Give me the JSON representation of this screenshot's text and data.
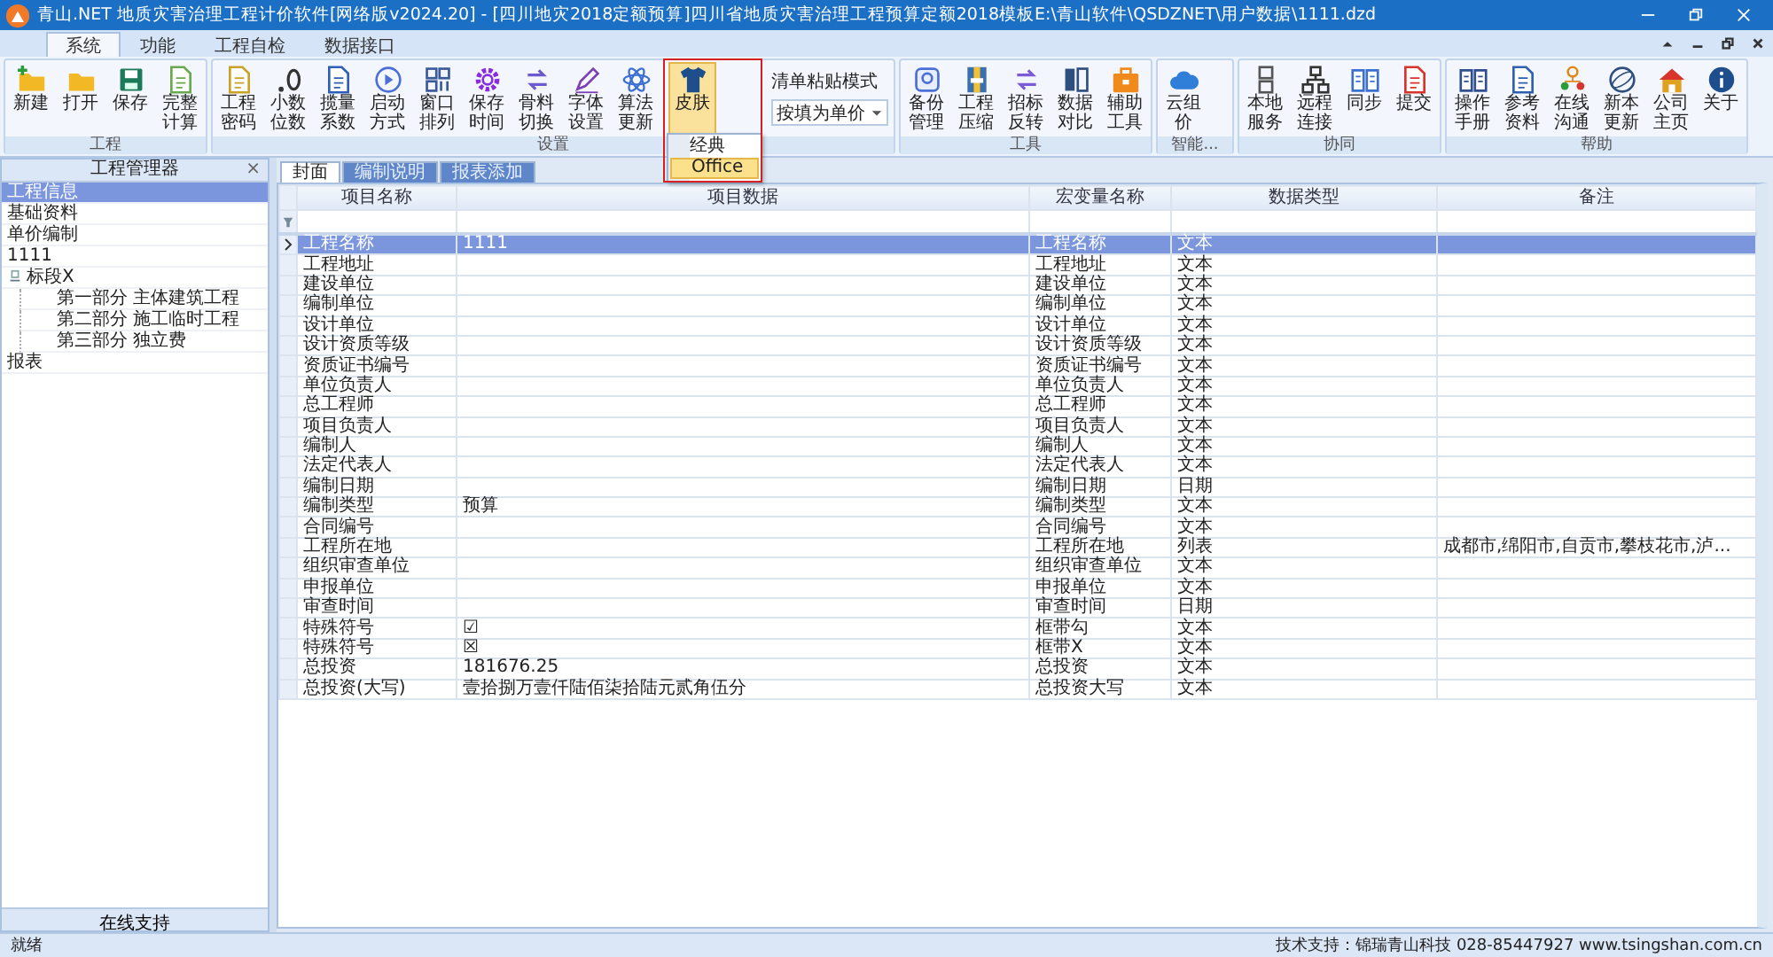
{
  "window": {
    "title": "青山.NET 地质灾害治理工程计价软件[网络版v2024.20] - [四川地灾2018定额预算]四川省地质灾害治理工程预算定额2018模板E:\\青山软件\\QSDZNET\\用户数据\\1111.dzd"
  },
  "ribbon_tabs": [
    {
      "label": "系统",
      "selected": true
    },
    {
      "label": "功能",
      "selected": false
    },
    {
      "label": "工程自检",
      "selected": false
    },
    {
      "label": "数据接口",
      "selected": false
    }
  ],
  "ribbon_groups": [
    {
      "label": "工程",
      "items": [
        {
          "kind": "button",
          "label": "新建"
        },
        {
          "kind": "button",
          "label": "打开"
        },
        {
          "kind": "button",
          "label": "保存"
        },
        {
          "kind": "button",
          "label": "完整计算"
        }
      ]
    },
    {
      "label": "设置",
      "items": [
        {
          "kind": "button",
          "label": "工程密码"
        },
        {
          "kind": "button",
          "label": "小数位数"
        },
        {
          "kind": "button",
          "label": "揽量系数"
        },
        {
          "kind": "button",
          "label": "启动方式"
        },
        {
          "kind": "button",
          "label": "窗口排列"
        },
        {
          "kind": "button",
          "label": "保存时间"
        },
        {
          "kind": "button",
          "label": "骨料切换"
        },
        {
          "kind": "button",
          "label": "字体设置"
        },
        {
          "kind": "button",
          "label": "算法更新"
        },
        {
          "kind": "button",
          "label": "皮肤",
          "menu": [
            {
              "label": "经典",
              "selected": false
            },
            {
              "label": "Office",
              "selected": true
            }
          ]
        },
        {
          "kind": "combo",
          "label": "清单粘贴模式",
          "value": "按填为单价"
        }
      ]
    },
    {
      "label": "工具",
      "items": [
        {
          "kind": "button",
          "label": "备份管理"
        },
        {
          "kind": "button",
          "label": "工程压缩"
        },
        {
          "kind": "button",
          "label": "招标反转"
        },
        {
          "kind": "button",
          "label": "数据对比"
        },
        {
          "kind": "button",
          "label": "辅助工具"
        }
      ]
    },
    {
      "label": "智能...",
      "items": [
        {
          "kind": "button",
          "label": "云组价"
        }
      ]
    },
    {
      "label": "协同",
      "items": [
        {
          "kind": "button",
          "label": "本地服务"
        },
        {
          "kind": "button",
          "label": "远程连接"
        },
        {
          "kind": "button",
          "label": "同步"
        },
        {
          "kind": "button",
          "label": "提交"
        }
      ]
    },
    {
      "label": "帮助",
      "items": [
        {
          "kind": "button",
          "label": "操作手册"
        },
        {
          "kind": "button",
          "label": "参考资料"
        },
        {
          "kind": "button",
          "label": "在线沟通"
        },
        {
          "kind": "button",
          "label": "新本更新"
        },
        {
          "kind": "button",
          "label": "公司主页"
        },
        {
          "kind": "button",
          "label": "关于"
        }
      ]
    }
  ],
  "sidebar": {
    "title": "工程管理器",
    "close": "×",
    "items": [
      {
        "label": "工程信息",
        "selected": true
      },
      {
        "label": "基础资料",
        "selected": false
      },
      {
        "label": "单价编制",
        "selected": false
      },
      {
        "label": "1111",
        "selected": false
      },
      {
        "label": "标段X",
        "selected": false,
        "expanded": true,
        "children": [
          {
            "label": "第一部分 主体建筑工程",
            "selected": false
          },
          {
            "label": "第二部分 施工临时工程",
            "selected": false
          },
          {
            "label": "第三部分 独立费",
            "selected": false
          }
        ]
      },
      {
        "label": "报表",
        "selected": false
      }
    ],
    "footer_button": "在线支持"
  },
  "doc_tabs": [
    {
      "label": "封面",
      "selected": true
    },
    {
      "label": "编制说明",
      "selected": false
    },
    {
      "label": "报表添加",
      "selected": false
    }
  ],
  "table": {
    "columns": [
      "项目名称",
      "项目数据",
      "宏变量名称",
      "数据类型",
      "备注"
    ],
    "rows": [
      {
        "selected": true,
        "cells": [
          "工程名称",
          "1111",
          "工程名称",
          "文本",
          ""
        ]
      },
      {
        "selected": false,
        "cells": [
          "工程地址",
          "",
          "工程地址",
          "文本",
          ""
        ]
      },
      {
        "selected": false,
        "cells": [
          "建设单位",
          "",
          "建设单位",
          "文本",
          ""
        ]
      },
      {
        "selected": false,
        "cells": [
          "编制单位",
          "",
          "编制单位",
          "文本",
          ""
        ]
      },
      {
        "selected": false,
        "cells": [
          "设计单位",
          "",
          "设计单位",
          "文本",
          ""
        ]
      },
      {
        "selected": false,
        "cells": [
          "设计资质等级",
          "",
          "设计资质等级",
          "文本",
          ""
        ]
      },
      {
        "selected": false,
        "cells": [
          "资质证书编号",
          "",
          "资质证书编号",
          "文本",
          ""
        ]
      },
      {
        "selected": false,
        "cells": [
          "单位负责人",
          "",
          "单位负责人",
          "文本",
          ""
        ]
      },
      {
        "selected": false,
        "cells": [
          "总工程师",
          "",
          "总工程师",
          "文本",
          ""
        ]
      },
      {
        "selected": false,
        "cells": [
          "项目负责人",
          "",
          "项目负责人",
          "文本",
          ""
        ]
      },
      {
        "selected": false,
        "cells": [
          "编制人",
          "",
          "编制人",
          "文本",
          ""
        ]
      },
      {
        "selected": false,
        "cells": [
          "法定代表人",
          "",
          "法定代表人",
          "文本",
          ""
        ]
      },
      {
        "selected": false,
        "cells": [
          "编制日期",
          "",
          "编制日期",
          "日期",
          ""
        ]
      },
      {
        "selected": false,
        "cells": [
          "编制类型",
          "预算",
          "编制类型",
          "文本",
          ""
        ]
      },
      {
        "selected": false,
        "cells": [
          "合同编号",
          "",
          "合同编号",
          "文本",
          ""
        ]
      },
      {
        "selected": false,
        "cells": [
          "工程所在地",
          "",
          "工程所在地",
          "列表",
          "成都市,绵阳市,自贡市,攀枝花市,泸..."
        ]
      },
      {
        "selected": false,
        "cells": [
          "组织审查单位",
          "",
          "组织审查单位",
          "文本",
          ""
        ]
      },
      {
        "selected": false,
        "cells": [
          "申报单位",
          "",
          "申报单位",
          "文本",
          ""
        ]
      },
      {
        "selected": false,
        "cells": [
          "审查时间",
          "",
          "审查时间",
          "日期",
          ""
        ]
      },
      {
        "selected": false,
        "cells": [
          "特殊符号",
          "☑",
          "框带勾",
          "文本",
          ""
        ]
      },
      {
        "selected": false,
        "cells": [
          "特殊符号",
          "☒",
          "框带X",
          "文本",
          ""
        ]
      },
      {
        "selected": false,
        "cells": [
          "总投资",
          "181676.25",
          "总投资",
          "文本",
          ""
        ]
      },
      {
        "selected": false,
        "cells": [
          "总投资(大写)",
          "壹拾捌万壹仟陆佰柒拾陆元贰角伍分",
          "总投资大写",
          "文本",
          ""
        ]
      }
    ]
  },
  "status_bar": {
    "left": "就绪",
    "right": "技术支持：锦瑞青山科技 028-85447927 www.tsingshan.com.cn"
  }
}
